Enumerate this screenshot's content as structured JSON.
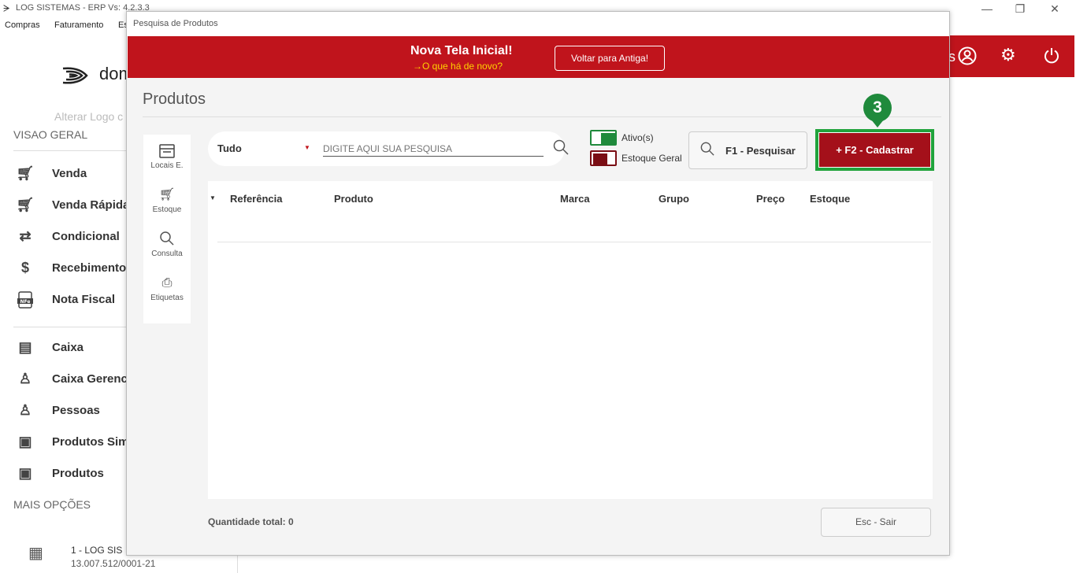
{
  "window": {
    "title": "LOG SISTEMAS - ERP Vs: 4.2.3.3",
    "controls": [
      "—",
      "❐",
      "✕"
    ]
  },
  "menubar": {
    "items": [
      "Compras",
      "Faturamento",
      "Es"
    ]
  },
  "app_header": {
    "user_partial": "s",
    "icons": [
      "user-icon",
      "gear-icon",
      "power-icon"
    ]
  },
  "sidebar": {
    "brand": "dom",
    "alter_logo": "Alterar Logo c",
    "section_main": "VISAO GERAL",
    "items_a": [
      {
        "label": "Venda",
        "icon": "cart-icon"
      },
      {
        "label": "Venda Rápida",
        "icon": "cart-icon"
      },
      {
        "label": "Condicional",
        "icon": "cart-transfer-icon"
      },
      {
        "label": "Recebimento",
        "icon": "money-hand-icon"
      },
      {
        "label": "Nota Fiscal",
        "icon": "nfe-icon"
      }
    ],
    "items_b": [
      {
        "label": "Caixa",
        "icon": "register-icon"
      },
      {
        "label": "Caixa Gerenc",
        "icon": "person-money-icon"
      },
      {
        "label": "Pessoas",
        "icon": "people-icon"
      },
      {
        "label": "Produtos Sim",
        "icon": "box-icon"
      },
      {
        "label": "Produtos",
        "icon": "box-icon"
      }
    ],
    "section_more": "MAIS OPÇÕES",
    "company_name": "1 - LOG SIS",
    "company_cnpj": "13.007.512/0001-21"
  },
  "dialog": {
    "title": "Pesquisa de Produtos",
    "banner": {
      "headline": "Nova Tela Inicial!",
      "subline": "→O que há de novo?",
      "back_button": "Voltar para Antiga!"
    },
    "page_title": "Produtos",
    "tools": [
      {
        "label": "Locais E.",
        "icon": "locais-icon"
      },
      {
        "label": "Estoque",
        "icon": "cart-icon"
      },
      {
        "label": "Consulta",
        "icon": "search-icon"
      },
      {
        "label": "Etiquetas",
        "icon": "label-printer-icon"
      }
    ],
    "search": {
      "filter_value": "Tudo",
      "placeholder": "DIGITE AQUI SUA PESQUISA"
    },
    "checkboxes": [
      {
        "label": "Ativo(s)",
        "color": "#1f8a3c",
        "checked": true
      },
      {
        "label": "Estoque Geral",
        "color": "#7a0e14",
        "checked": true
      }
    ],
    "buttons": {
      "search": "F1 - Pesquisar",
      "register": "+  F2 - Cadastrar",
      "exit": "Esc - Sair"
    },
    "step_badge": "3",
    "table": {
      "columns": [
        "Referência",
        "Produto",
        "Marca",
        "Grupo",
        "Preço",
        "Estoque"
      ],
      "rows": []
    },
    "total_label": "Quantidade total: 0"
  },
  "colors": {
    "brand_red": "#c0141c",
    "register_red": "#a4101a",
    "highlight_green": "#21a33c",
    "banner_yellow": "#ffd200"
  }
}
